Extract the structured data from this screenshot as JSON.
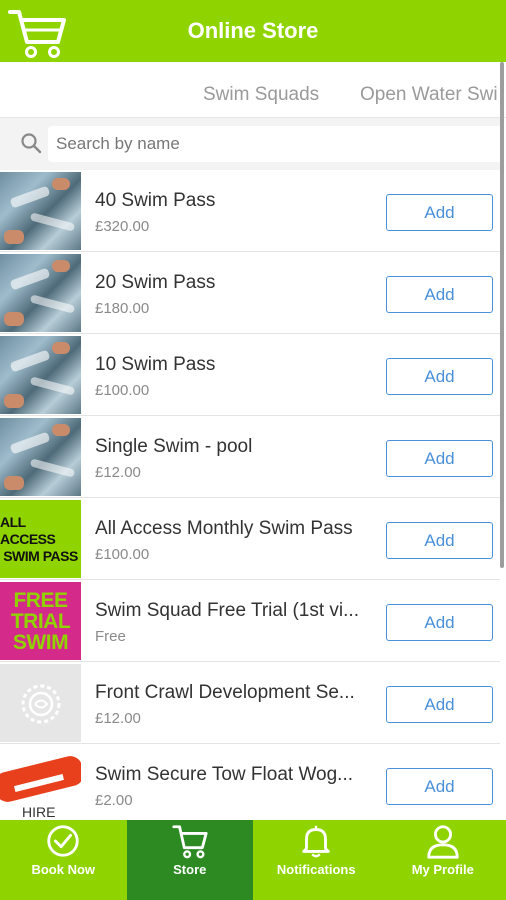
{
  "header": {
    "title": "Online Store",
    "icon": "cart-icon"
  },
  "tabs": [
    {
      "label": "Swim Squads"
    },
    {
      "label": "Open Water Swi"
    }
  ],
  "search": {
    "placeholder": "Search by name",
    "icon": "search-icon"
  },
  "products": [
    {
      "name": "40 Swim Pass",
      "price": "£320.00",
      "thumb": "pool",
      "add": "Add"
    },
    {
      "name": "20 Swim Pass",
      "price": "£180.00",
      "thumb": "pool",
      "add": "Add"
    },
    {
      "name": "10 Swim Pass",
      "price": "£100.00",
      "thumb": "pool",
      "add": "Add"
    },
    {
      "name": "Single Swim - pool",
      "price": "£12.00",
      "thumb": "pool",
      "add": "Add"
    },
    {
      "name": "All Access Monthly Swim Pass",
      "price": "£100.00",
      "thumb": "access",
      "thumb_text": [
        "ALL ACCESS",
        "SWIM PASS"
      ],
      "add": "Add"
    },
    {
      "name": "Swim Squad Free Trial (1st vi...",
      "price": "Free",
      "thumb": "trial",
      "thumb_text": [
        "FREE",
        "TRIAL",
        "SWIM"
      ],
      "add": "Add"
    },
    {
      "name": "Front Crawl Development Se...",
      "price": "£12.00",
      "thumb": "badge",
      "add": "Add"
    },
    {
      "name": "Swim Secure Tow Float Wog...",
      "price": "£2.00",
      "thumb": "hire",
      "thumb_text": [
        "HIRE"
      ],
      "add": "Add"
    }
  ],
  "nav": [
    {
      "label": "Book Now",
      "icon": "check-circle-icon",
      "active": false
    },
    {
      "label": "Store",
      "icon": "cart-icon",
      "active": true
    },
    {
      "label": "Notifications",
      "icon": "bell-icon",
      "active": false
    },
    {
      "label": "My Profile",
      "icon": "user-icon",
      "active": false
    }
  ],
  "colors": {
    "brand": "#8fd400",
    "active_nav": "#2d8a23",
    "button": "#4a90d9"
  }
}
